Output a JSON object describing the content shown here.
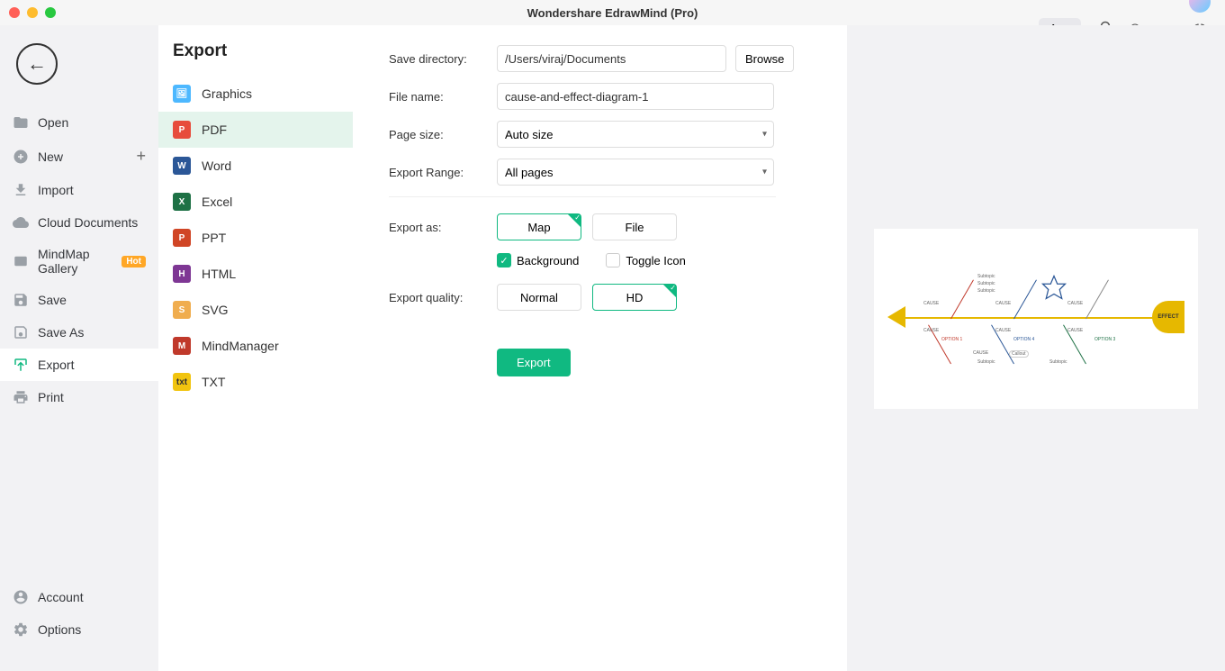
{
  "window": {
    "title": "Wondershare EdrawMind (Pro)"
  },
  "sidebar": {
    "items": [
      {
        "label": "Open"
      },
      {
        "label": "New"
      },
      {
        "label": "Import"
      },
      {
        "label": "Cloud Documents"
      },
      {
        "label": "MindMap Gallery",
        "hot": "Hot"
      },
      {
        "label": "Save"
      },
      {
        "label": "Save As"
      },
      {
        "label": "Export"
      },
      {
        "label": "Print"
      }
    ],
    "bottom": [
      {
        "label": "Account"
      },
      {
        "label": "Options"
      }
    ]
  },
  "export_panel": {
    "title": "Export",
    "types": [
      {
        "label": "Graphics",
        "color": "#4db8ff"
      },
      {
        "label": "PDF",
        "color": "#e74c3c"
      },
      {
        "label": "Word",
        "color": "#2b5797"
      },
      {
        "label": "Excel",
        "color": "#1e7145"
      },
      {
        "label": "PPT",
        "color": "#d04525"
      },
      {
        "label": "HTML",
        "color": "#7e3794"
      },
      {
        "label": "SVG",
        "color": "#f0ad4e"
      },
      {
        "label": "MindManager",
        "color": "#c0392b"
      },
      {
        "label": "TXT",
        "color": "#f1c40f"
      }
    ]
  },
  "form": {
    "save_dir_label": "Save directory:",
    "save_dir_value": "/Users/viraj/Documents",
    "browse": "Browse",
    "file_name_label": "File name:",
    "file_name_value": "cause-and-effect-diagram-1",
    "page_size_label": "Page size:",
    "page_size_value": "Auto size",
    "export_range_label": "Export Range:",
    "export_range_value": "All pages",
    "export_as_label": "Export as:",
    "export_as_map": "Map",
    "export_as_file": "File",
    "background": "Background",
    "toggle_icon": "Toggle Icon",
    "export_quality_label": "Export quality:",
    "quality_normal": "Normal",
    "quality_hd": "HD",
    "export_btn": "Export"
  },
  "topbar": {
    "app": "App"
  },
  "preview": {
    "effect": "EFFECT",
    "option1": "OPTION 1",
    "option3": "OPTION 3",
    "option4": "OPTION 4",
    "cause": "CAUSE",
    "subtopic": "Subtopic",
    "callout": "Callout"
  }
}
